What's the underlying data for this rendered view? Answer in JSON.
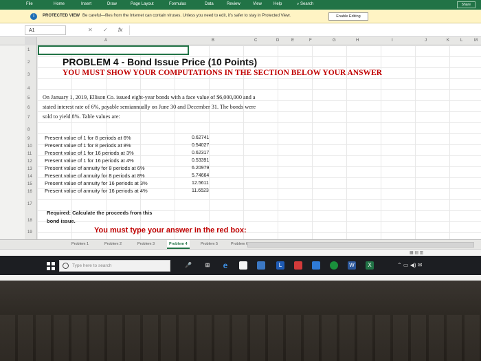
{
  "ribbon": {
    "tabs": [
      "File",
      "Home",
      "Insert",
      "Draw",
      "Page Layout",
      "Formulas",
      "Data",
      "Review",
      "View",
      "Help"
    ],
    "search": "Search",
    "share": "Share"
  },
  "protected_view": {
    "label": "PROTECTED VIEW",
    "message": "Be careful—files from the Internet can contain viruses. Unless you need to edit, it's safer to stay in Protected View.",
    "button": "Enable Editing"
  },
  "formula_bar": {
    "cell_ref": "A1",
    "cancel": "✕",
    "enter": "✓",
    "fx": "fx",
    "value": ""
  },
  "columns": [
    "A",
    "B",
    "C",
    "D",
    "E",
    "F",
    "G",
    "H",
    "I",
    "J",
    "K",
    "L",
    "M"
  ],
  "rows": [
    "1",
    "2",
    "3",
    "4",
    "5",
    "6",
    "7",
    "8",
    "9",
    "10",
    "11",
    "12",
    "13",
    "14",
    "15",
    "16",
    "17",
    "18",
    "19"
  ],
  "sheet": {
    "title": "PROBLEM 4 - Bond Issue Price (10 Points)",
    "subtitle": "YOU MUST SHOW YOUR COMPUTATIONS IN THE SECTION BELOW YOUR ANSWER",
    "paragraph": [
      "On January 1, 2019, Ellison Co. issued eight-year bonds with a face value of $6,000,000 and a",
      "stated interest rate of 6%, payable semiannually on June 30 and December 31. The bonds were",
      "sold to yield 8%. Table values are:"
    ],
    "table": [
      {
        "label": "Present value of 1 for 8 periods at 6%",
        "value": "0.62741"
      },
      {
        "label": "Present value of 1 for 8 periods at 8%",
        "value": "0.54027"
      },
      {
        "label": "Present value of 1 for 16 periods at 3%",
        "value": "0.62317"
      },
      {
        "label": "Present value of 1 for 16 periods at 4%",
        "value": "0.53391"
      },
      {
        "label": "Present value of annuity for 8 periods at 6%",
        "value": "6.20979"
      },
      {
        "label": "Present value of annuity for 8 periods at 8%",
        "value": "5.74664"
      },
      {
        "label": "Present value of annuity for 16 periods at 3%",
        "value": "12.5611"
      },
      {
        "label": "Present value of annuity for 16 periods at 4%",
        "value": "11.6523"
      }
    ],
    "required_1": "Required: Calculate the proceeds from this",
    "required_2": "bond issue.",
    "answer_prompt": "You must type your answer in the red box:"
  },
  "sheet_tabs": [
    "Problem 1",
    "Problem 2",
    "Problem 3",
    "Problem 4",
    "Problem 5",
    "Problem 6"
  ],
  "active_sheet": "Problem 4",
  "taskbar": {
    "search_placeholder": "Type here to search"
  },
  "colors": {
    "excel_green": "#217346",
    "warning_yellow": "#fff4c4",
    "red_text": "#c00000",
    "taskbar": "#1c1e22"
  }
}
